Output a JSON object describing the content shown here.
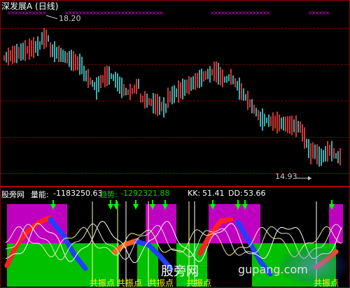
{
  "title": "深发展A (日线)",
  "price": {
    "high_label": "18.20",
    "low_label": "14.93"
  },
  "indicator": {
    "source": "股旁网",
    "volume_label": "量能:",
    "volume_value": "-1183250.63",
    "trend_label": "趋势:",
    "trend_value": "-1292321.88",
    "kk_label": "KK:",
    "kk_value": "51.41",
    "dd_label": "DD:",
    "dd_value": "53.66"
  },
  "signal_label": "共振点",
  "watermark": {
    "cn": "股旁网",
    "site": "gupang.com"
  },
  "colors": {
    "up": "#ff4444",
    "down": "#4fd9d9",
    "magenta": "#c000c0",
    "green": "#00c000",
    "arrow": "#00ff00",
    "x_mark": "#d800d8",
    "text_yellow": "#ffff00"
  }
}
